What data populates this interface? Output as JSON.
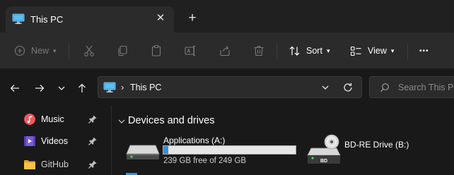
{
  "tab": {
    "title": "This PC",
    "close_glyph": "✕",
    "new_tab_glyph": "+"
  },
  "toolbar": {
    "new_label": "New",
    "sort_label": "Sort",
    "view_label": "View",
    "more_glyph": "•••",
    "icons": [
      "new-icon",
      "cut-icon",
      "copy-icon",
      "paste-icon",
      "rename-icon",
      "share-icon",
      "delete-icon",
      "sort-icon",
      "view-icon",
      "more-icon"
    ]
  },
  "address": {
    "path": "This PC",
    "separator": "›"
  },
  "search": {
    "placeholder": "Search This PC"
  },
  "sidebar": {
    "items": [
      {
        "label": "Music",
        "icon": "music-icon",
        "pinned": true
      },
      {
        "label": "Videos",
        "icon": "videos-icon",
        "pinned": true
      },
      {
        "label": "GitHub",
        "icon": "folder-icon",
        "pinned": true
      }
    ]
  },
  "section": {
    "title": "Devices and drives"
  },
  "drives": [
    {
      "name": "Applications (A:)",
      "free_text": "239 GB free of 249 GB",
      "used_fraction": 0.04,
      "icon": "hard-drive-icon"
    },
    {
      "name": "BD-RE Drive (B:)",
      "icon": "bd-drive-icon",
      "badge": "BD"
    }
  ],
  "colors": {
    "accent": "#3a8fd6",
    "window_bg": "#191919",
    "toolbar_bg": "#2b2b2b",
    "disabled": "#7a7a7a",
    "music_icon": "#e8486a",
    "videos_icon": "#7b5cd6",
    "folder_icon": "#f4b63c"
  }
}
